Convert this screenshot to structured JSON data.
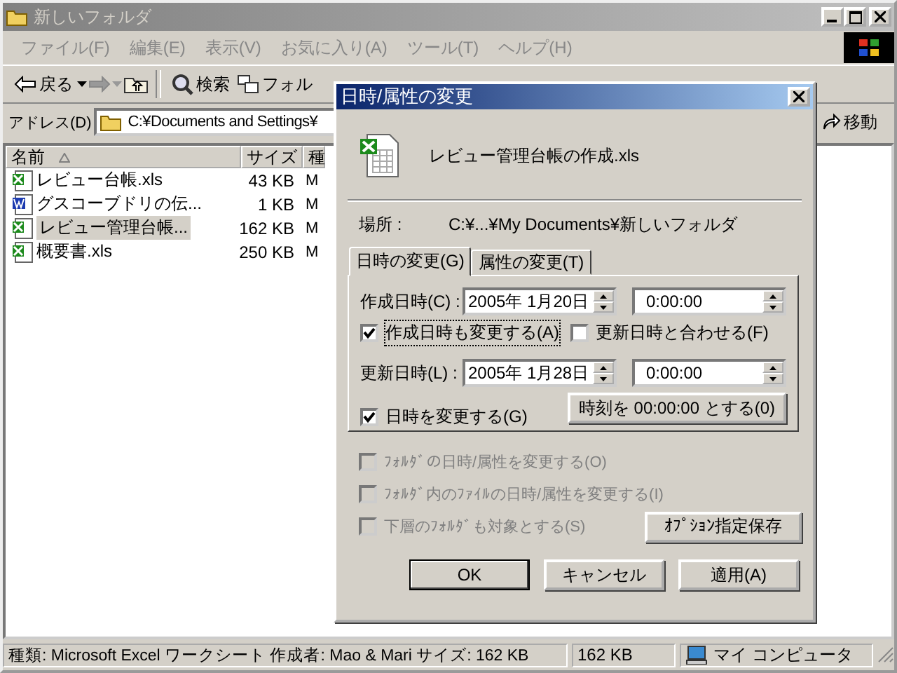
{
  "window": {
    "title": "新しいフォルダ"
  },
  "menu": [
    "ファイル(F)",
    "編集(E)",
    "表示(V)",
    "お気に入り(A)",
    "ツール(T)",
    "ヘルプ(H)"
  ],
  "toolbar": {
    "back": "戻る",
    "search": "検索",
    "folders": "フォル"
  },
  "address": {
    "label": "アドレス(D)",
    "value": "C:¥Documents and Settings¥",
    "go": "移動"
  },
  "columns": [
    "名前",
    "サイズ",
    "種"
  ],
  "files": [
    {
      "kind": "excel",
      "name": "レビュー台帳.xls",
      "size": "43 KB",
      "column_3": "M",
      "selected": false
    },
    {
      "kind": "word",
      "name": "グスコーブドリの伝...",
      "size": "1 KB",
      "column_3": "M",
      "selected": false
    },
    {
      "kind": "excel",
      "name": "レビュー管理台帳...",
      "size": "162 KB",
      "column_3": "M",
      "selected": true
    },
    {
      "kind": "excel",
      "name": "概要書.xls",
      "size": "250 KB",
      "column_3": "M",
      "selected": false
    }
  ],
  "status_bar": {
    "info": "種類: Microsoft Excel ワークシート 作成者: Mao & Mari サイズ: 162 KB",
    "size": "162 KB",
    "zone": "マイ コンピュータ"
  },
  "dialog": {
    "title": "日時/属性の変更",
    "file_name": "レビュー管理台帳の作成.xls",
    "location_label": "場所 :",
    "location_value": "C:¥...¥My Documents¥新しいフォルダ",
    "tabs": [
      {
        "label": "日時の変更(G)",
        "selected": true
      },
      {
        "label": "属性の変更(T)",
        "selected": false
      }
    ],
    "created": {
      "label": "作成日時(C) :",
      "date": "2005年  1月20日",
      "time": "0:00:00"
    },
    "checks": [
      {
        "label": "作成日時も変更する(A)",
        "checked": true
      },
      {
        "label": "更新日時と合わせる(F)",
        "checked": false
      }
    ],
    "modified": {
      "label": "更新日時(L) :",
      "date": "2005年  1月28日",
      "time": "0:00:00"
    },
    "change_datetime": {
      "label": "日時を変更する(G)",
      "checked": true
    },
    "zero_time_button": "時刻を 00:00:00 とする(0)",
    "options": [
      {
        "label": "ﾌｫﾙﾀﾞの日時/属性を変更する(O)",
        "checked": false,
        "disabled": true
      },
      {
        "label": "ﾌｫﾙﾀﾞ内のﾌｧｲﾙの日時/属性を変更する(I)",
        "checked": false,
        "disabled": true
      },
      {
        "label": "下層のﾌｫﾙﾀﾞも対象とする(S)",
        "checked": false,
        "disabled": true
      }
    ],
    "save_options_button": "ｵﾌﾟｼｮﾝ指定保存",
    "buttons": [
      "OK",
      "キャンセル",
      "適用(A)"
    ]
  }
}
